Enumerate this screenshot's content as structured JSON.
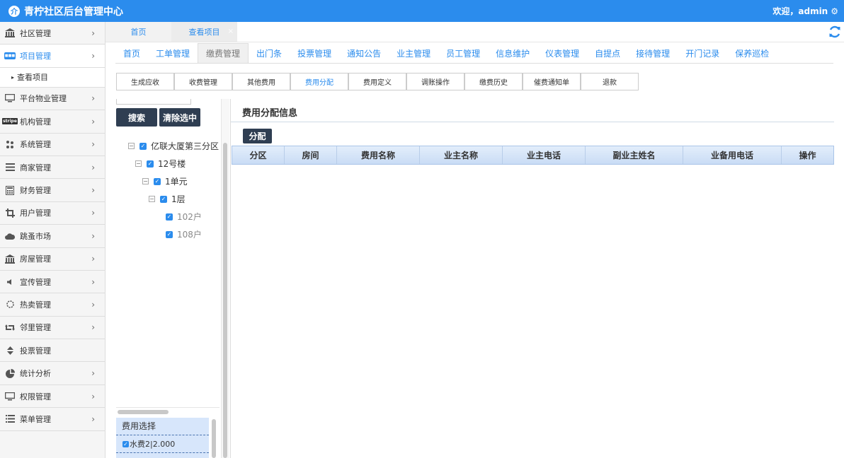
{
  "header": {
    "logo_glyph": "介",
    "title": "青柠社区后台管理中心",
    "welcome": "欢迎，admin",
    "gear": "⚙"
  },
  "sidebar": {
    "items": [
      {
        "label": "社区管理",
        "icon": "bank-icon"
      },
      {
        "label": "项目管理",
        "icon": "project-icon",
        "active": true
      },
      {
        "label": "查看项目",
        "sub": true
      },
      {
        "label": "平台物业管理",
        "icon": "monitor-icon"
      },
      {
        "label": "机构管理",
        "icon": "stripe-icon",
        "icon_text": "stripe"
      },
      {
        "label": "系统管理",
        "icon": "yelp-icon"
      },
      {
        "label": "商家管理",
        "icon": "bars-icon"
      },
      {
        "label": "财务管理",
        "icon": "calculator-icon"
      },
      {
        "label": "用户管理",
        "icon": "crop-icon"
      },
      {
        "label": "跳蚤市场",
        "icon": "cloud-icon"
      },
      {
        "label": "房屋管理",
        "icon": "bank-icon"
      },
      {
        "label": "宣传管理",
        "icon": "volume-icon"
      },
      {
        "label": "热卖管理",
        "icon": "gear-outline-icon"
      },
      {
        "label": "邻里管理",
        "icon": "retweet-icon"
      },
      {
        "label": "投票管理",
        "icon": "sort-icon"
      },
      {
        "label": "统计分析",
        "icon": "pie-icon"
      },
      {
        "label": "权限管理",
        "icon": "desktop-icon"
      },
      {
        "label": "菜单管理",
        "icon": "list-icon"
      }
    ]
  },
  "page_tabs": [
    {
      "label": "首页"
    },
    {
      "label": "查看项目",
      "close": "×"
    }
  ],
  "module_tabs": [
    "首页",
    "工单管理",
    "缴费管理",
    "出门条",
    "投票管理",
    "通知公告",
    "业主管理",
    "员工管理",
    "信息维护",
    "仪表管理",
    "自提点",
    "接待管理",
    "开门记录",
    "保养巡检"
  ],
  "module_active": 2,
  "sub_buttons": [
    "生成应收",
    "收费管理",
    "其他费用",
    "费用分配",
    "费用定义",
    "调账操作",
    "缴费历史",
    "催费通知单",
    "退款"
  ],
  "sub_active": 3,
  "tree": {
    "search_label": "搜索",
    "clear_label": "清除选中",
    "nodes": [
      {
        "label": "亿联大厦第三分区",
        "toggle": "−"
      },
      {
        "label": "12号楼",
        "toggle": "−"
      },
      {
        "label": "1单元",
        "toggle": "−"
      },
      {
        "label": "1层",
        "toggle": "−"
      },
      {
        "label": "102户"
      },
      {
        "label": "108户"
      }
    ]
  },
  "fee_select": {
    "title": "费用选择",
    "item": "水费2|2.000"
  },
  "main": {
    "title": "费用分配信息",
    "assign_label": "分配",
    "columns": [
      "分区",
      "房间",
      "费用名称",
      "业主名称",
      "业主电话",
      "副业主姓名",
      "业备用电话",
      "操作"
    ]
  }
}
